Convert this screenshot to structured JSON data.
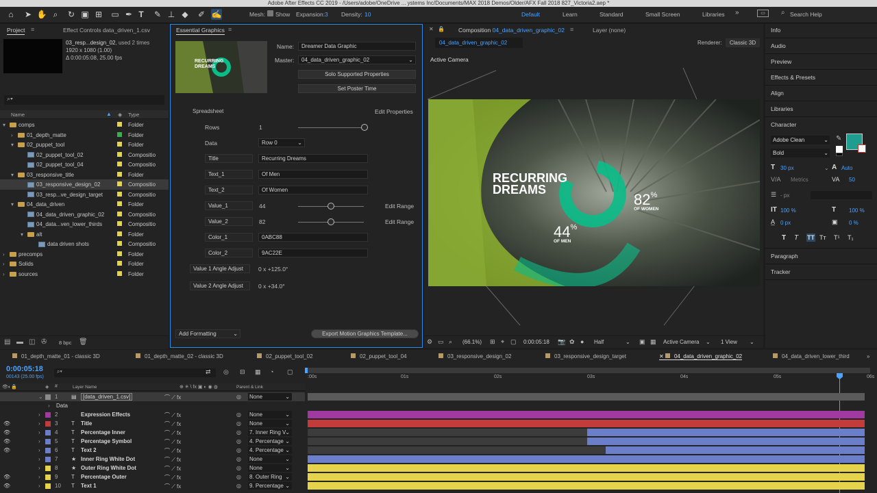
{
  "window_title": "Adobe After Effects CC 2019 - /Users/adobe/OneDrive ... ystems Inc/Documents/MAX 2018 Demos/Older/AFX Fall 2018 827_Victoria2.aep *",
  "toolbar": {
    "mesh_label": "Mesh:",
    "show_label": "Show",
    "expansion_label": "Expansion:",
    "expansion_value": "3",
    "density_label": "Density:",
    "density_value": "10",
    "workspaces": [
      "Default",
      "Learn",
      "Standard",
      "Small Screen",
      "Libraries"
    ],
    "search_placeholder": "Search Help"
  },
  "project": {
    "tab_project": "Project",
    "tab_effect_controls": "Effect Controls data_driven_1.csv",
    "preview_name": "03_resp...design_02",
    "preview_used": ", used 2 times",
    "preview_dims": "1920 x 1080 (1.00)",
    "preview_duration": "Δ 0:00:05:08, 25.00 fps",
    "col_name": "Name",
    "col_type": "Type",
    "bpc": "8 bpc",
    "items": [
      {
        "name": "comps",
        "type": "Folder",
        "kind": "folder",
        "color": "#e5d34b"
      },
      {
        "name": "01_depth_matte",
        "type": "Folder",
        "kind": "folder",
        "color": "#36b04a"
      },
      {
        "name": "02_puppet_tool",
        "type": "Folder",
        "kind": "folder",
        "color": "#e5d34b"
      },
      {
        "name": "02_puppet_tool_02",
        "type": "Compositio",
        "kind": "comp",
        "color": "#e5d34b"
      },
      {
        "name": "02_puppet_tool_04",
        "type": "Compositio",
        "kind": "comp",
        "color": "#e5d34b"
      },
      {
        "name": "03_responsive_title",
        "type": "Folder",
        "kind": "folder",
        "color": "#e5d34b"
      },
      {
        "name": "03_responsive_design_02",
        "type": "Compositio",
        "kind": "comp",
        "color": "#e5d34b"
      },
      {
        "name": "03_resp...ve_design_target",
        "type": "Compositio",
        "kind": "comp",
        "color": "#e5d34b"
      },
      {
        "name": "04_data_driven",
        "type": "Folder",
        "kind": "folder",
        "color": "#e5d34b"
      },
      {
        "name": "04_data_driven_graphic_02",
        "type": "Compositio",
        "kind": "comp",
        "color": "#e5d34b"
      },
      {
        "name": "04_data...ven_lower_thirds",
        "type": "Compositio",
        "kind": "comp",
        "color": "#e5d34b"
      },
      {
        "name": "alt",
        "type": "Folder",
        "kind": "folder",
        "color": "#e5d34b"
      },
      {
        "name": "data driven shots",
        "type": "Compositio",
        "kind": "comp",
        "color": "#e5d34b"
      },
      {
        "name": "precomps",
        "type": "Folder",
        "kind": "folder",
        "color": "#e5d34b"
      },
      {
        "name": "Solids",
        "type": "Folder",
        "kind": "folder",
        "color": "#e5d34b"
      },
      {
        "name": "sources",
        "type": "Folder",
        "kind": "folder",
        "color": "#e5d34b"
      }
    ]
  },
  "eg": {
    "tab": "Essential Graphics",
    "name_label": "Name:",
    "name_value": "Dreamer Data Graphic",
    "master_label": "Master:",
    "master_value": "04_data_driven_graphic_02",
    "solo_button": "Solo Supported Properties",
    "poster_button": "Set Poster Time",
    "thumb_title": "RECURRING DREAMS",
    "spreadsheet_label": "Spreadsheet",
    "edit_properties": "Edit Properties",
    "rows_label": "Rows",
    "rows_value": "1",
    "data_label": "Data",
    "data_value": "Row 0",
    "title_label": "Title",
    "title_value": "Recurring Dreams",
    "text1_label": "Text_1",
    "text1_value": "Of Men",
    "text2_label": "Text_2",
    "text2_value": "Of Women",
    "value1_label": "Value_1",
    "value1_value": "44",
    "value2_label": "Value_2",
    "value2_value": "82",
    "edit_range": "Edit Range",
    "color1_label": "Color_1",
    "color1_value": "0ABC88",
    "color2_label": "Color_2",
    "color2_value": "9AC22E",
    "angle1_label": "Value 1 Angle Adjust",
    "angle1_value": "0 x +125.0°",
    "angle2_label": "Value 2 Angle Adjust",
    "angle2_value": "0 x +34.0°",
    "add_formatting": "Add Formatting",
    "export_button": "Export Motion Graphics Template..."
  },
  "comp": {
    "tab": "Composition",
    "tab_name": "04_data_driven_graphic_02",
    "layer_tab": "Layer (none)",
    "sub_tab": "04_data_driven_graphic_02",
    "renderer_label": "Renderer:",
    "renderer_value": "Classic 3D",
    "camera_label": "Active Camera",
    "graphic_title_line1": "RECURRING",
    "graphic_title_line2": "DREAMS",
    "men_value": "44",
    "women_value": "82",
    "percent": "%",
    "men_label": "OF MEN",
    "women_label": "OF WOMEN",
    "colors": {
      "color1": "#0ABC88",
      "color2": "#9AC22E"
    },
    "zoom": "(66.1%)",
    "time": "0:00:05:18",
    "resolution": "Half",
    "view_camera": "Active Camera",
    "views": "1 View"
  },
  "right_panel": {
    "sections": [
      "Info",
      "Audio",
      "Preview",
      "Effects & Presets",
      "Align",
      "Libraries"
    ],
    "character": "Character",
    "font": "Adobe Clean",
    "style": "Bold",
    "size": "30 px",
    "leading": "Auto",
    "kerning": "Metrics",
    "tracking": "50",
    "stroke": "- px",
    "vscale": "100 %",
    "hscale": "100 %",
    "baseline": "0 px",
    "tsume": "0 %",
    "paragraph": "Paragraph",
    "tracker": "Tracker",
    "fill_color": "#1f9d8e"
  },
  "timeline": {
    "tabs": [
      "01_depth_matte_01 - classic 3D",
      "01_depth_matte_02 - classic 3D",
      "02_puppet_tool_02",
      "02_puppet_tool_04",
      "03_responsive_design_02",
      "03_responsive_design_target",
      "04_data_driven_graphic_02",
      "04_data_driven_lower_third"
    ],
    "timecode": "0:00:05:18",
    "frames": "00143 (25.00 fps)",
    "col_layer_name": "Layer Name",
    "col_parent": "Parent & Link",
    "ticks": [
      ":00s",
      "01s",
      "02s",
      "03s",
      "04s",
      "05s",
      "06s"
    ],
    "data_label": "Data",
    "layers": [
      {
        "idx": "1",
        "name": "[data_driven_1.csv]",
        "color": "#8a8a8a",
        "parent": "None"
      },
      {
        "idx": "2",
        "name": "Expression Effects",
        "color": "#a03aa0",
        "parent": "None"
      },
      {
        "idx": "3",
        "name": "Title",
        "color": "#c33b3b",
        "parent": "None"
      },
      {
        "idx": "4",
        "name": "Percentage Inner",
        "color": "#6a7ec9",
        "parent": "7. Inner Ring V"
      },
      {
        "idx": "5",
        "name": "Percentage Symbol",
        "color": "#6a7ec9",
        "parent": "4. Percentage"
      },
      {
        "idx": "6",
        "name": "Text 2",
        "color": "#6a7ec9",
        "parent": "4. Percentage"
      },
      {
        "idx": "7",
        "name": "Inner Ring White Dot",
        "color": "#6a7ec9",
        "parent": "None"
      },
      {
        "idx": "8",
        "name": "Outer Ring White Dot",
        "color": "#e5d34b",
        "parent": "None"
      },
      {
        "idx": "9",
        "name": "Percentage Outer",
        "color": "#e5d34b",
        "parent": "8. Outer Ring"
      },
      {
        "idx": "10",
        "name": "Text 1",
        "color": "#e5d34b",
        "parent": "9. Percentage"
      }
    ]
  }
}
